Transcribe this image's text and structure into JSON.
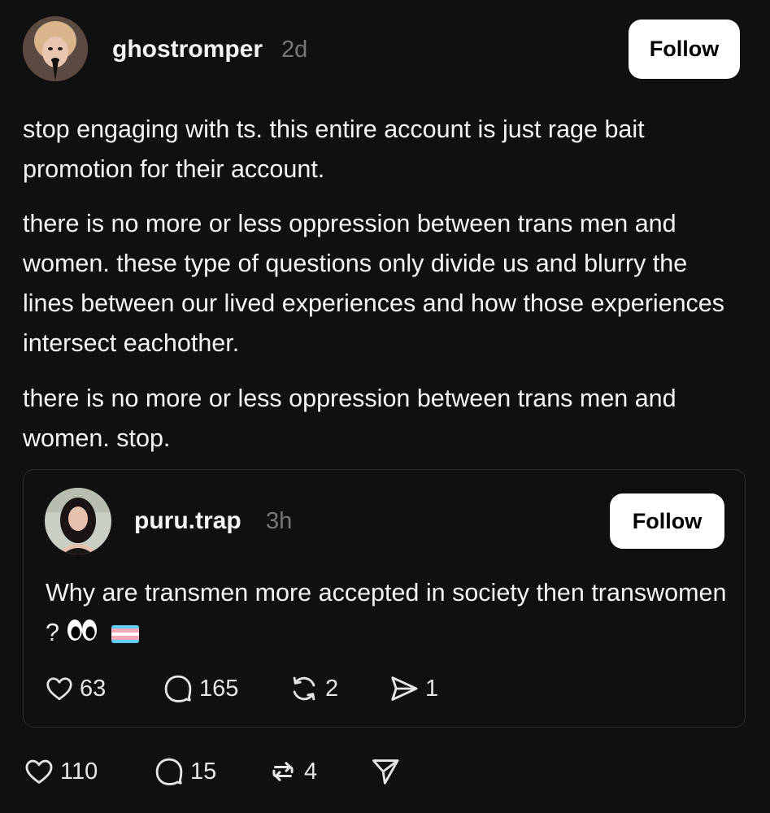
{
  "post": {
    "author": {
      "username": "ghostromper",
      "time": "2d"
    },
    "follow_label": "Follow",
    "paragraphs": [
      "stop engaging with ts. this entire account is just rage bait promotion for their account.",
      "there is no more or less oppression between trans men and women. these type of questions only divide us and blurry the lines between our lived experiences and how those experiences intersect eachother.",
      "there is no more or less oppression between trans men and women. stop."
    ],
    "stats": {
      "likes": "110",
      "replies": "15",
      "reposts": "4"
    }
  },
  "quoted": {
    "author": {
      "username": "puru.trap",
      "time": "3h"
    },
    "follow_label": "Follow",
    "text": "Why are transmen more accepted in society then transwomen ?",
    "stats": {
      "likes": "63",
      "replies": "165",
      "reposts": "2",
      "shares": "1"
    }
  },
  "icons": {
    "like": "heart-icon",
    "reply": "comment-bubble-icon",
    "repost": "repost-icon",
    "share": "send-icon",
    "eyes": "eyes-emoji",
    "flag": "transgender-flag-emoji"
  },
  "colors": {
    "background": "#101010",
    "text": "#f3f5f7",
    "muted": "#777777",
    "button_bg": "#ffffff",
    "border": "#2e2e2e",
    "flag_blue": "#5bcefa",
    "flag_pink": "#f5a9b8",
    "flag_white": "#ffffff"
  }
}
